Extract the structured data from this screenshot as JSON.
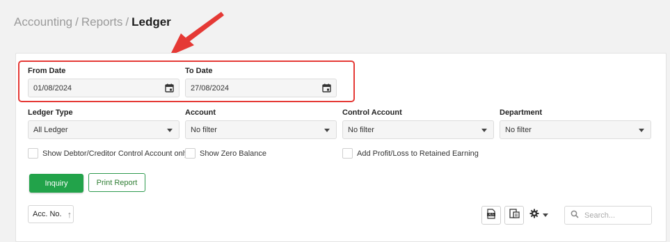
{
  "breadcrumb": {
    "items": [
      "Accounting",
      "Reports"
    ],
    "separator": "/",
    "current": "Ledger"
  },
  "filters": {
    "from_date": {
      "label": "From Date",
      "value": "01/08/2024",
      "icon": "calendar-icon"
    },
    "to_date": {
      "label": "To Date",
      "value": "27/08/2024",
      "icon": "calendar-icon"
    },
    "ledger_type": {
      "label": "Ledger Type",
      "value": "All Ledger"
    },
    "account": {
      "label": "Account",
      "value": "No filter"
    },
    "control_account": {
      "label": "Control Account",
      "value": "No filter"
    },
    "department": {
      "label": "Department",
      "value": "No filter"
    }
  },
  "checkboxes": {
    "debtor_creditor": "Show Debtor/Creditor Control Account only",
    "zero_balance": "Show Zero Balance",
    "profit_loss": "Add Profit/Loss to Retained Earning"
  },
  "buttons": {
    "inquiry": "Inquiry",
    "print_report": "Print Report"
  },
  "table": {
    "sort_label": "Acc. No.",
    "sort_icon": "sort-arrow-up-icon"
  },
  "toolbar": {
    "export_xls_icon": "xls-export-icon",
    "columns_icon": "columns-icon",
    "settings_icon": "gear-icon"
  },
  "search": {
    "placeholder": "Search..."
  },
  "colors": {
    "primary": "#22a34a",
    "highlight": "#e53935",
    "arrow": "#e53935"
  }
}
